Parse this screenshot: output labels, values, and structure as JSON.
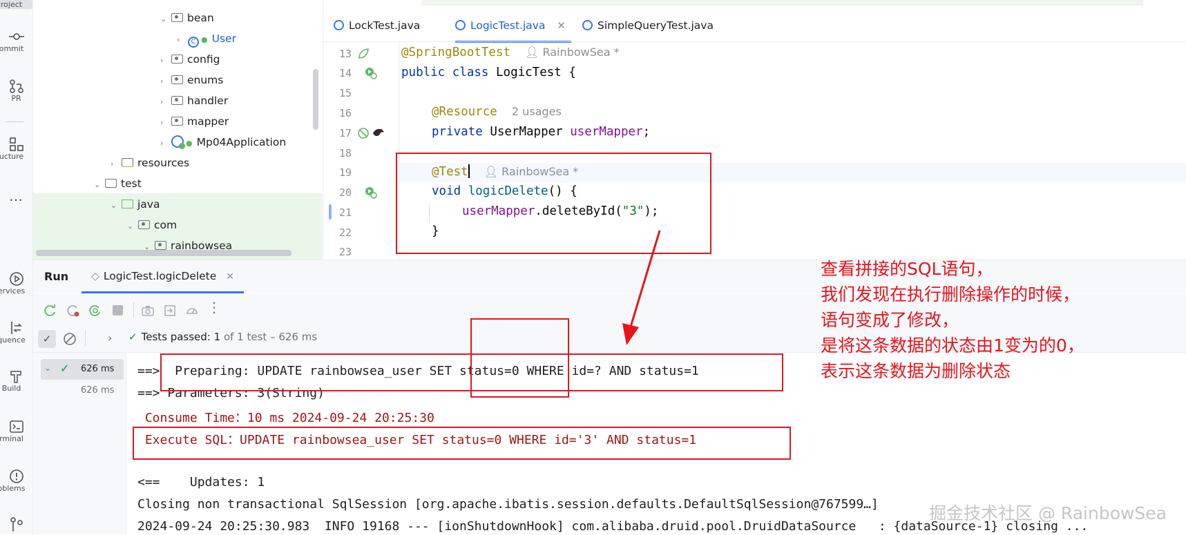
{
  "toolstrip": {
    "items": [
      {
        "label": "Project",
        "icon": "folder-icon"
      },
      {
        "label": "Commit",
        "icon": "commit-icon"
      },
      {
        "label": "PR",
        "icon": "pull-request-icon"
      },
      {
        "label": "Structure",
        "icon": "structure-icon"
      },
      {
        "label": "Services",
        "icon": "services-icon"
      },
      {
        "label": "Sequence",
        "icon": "sequence-icon"
      },
      {
        "label": "Build",
        "icon": "hammer-icon"
      },
      {
        "label": "Terminal",
        "icon": "terminal-icon"
      },
      {
        "label": "Problems",
        "icon": "problems-icon"
      }
    ],
    "labels_visible": [
      "roject",
      "ommit",
      "PR",
      "ucture",
      "ervices",
      "quence",
      "Build",
      "rminal",
      "oblems"
    ]
  },
  "tree": {
    "items": [
      {
        "label": "bean",
        "type": "package"
      },
      {
        "label": "User",
        "type": "class"
      },
      {
        "label": "config",
        "type": "package"
      },
      {
        "label": "enums",
        "type": "package"
      },
      {
        "label": "handler",
        "type": "package"
      },
      {
        "label": "mapper",
        "type": "package"
      },
      {
        "label": "Mp04Application",
        "type": "spring-class"
      },
      {
        "label": "resources",
        "type": "resources-folder"
      },
      {
        "label": "test",
        "type": "folder"
      },
      {
        "label": "java",
        "type": "test-source-folder"
      },
      {
        "label": "com",
        "type": "package"
      },
      {
        "label": "rainbowsea",
        "type": "package"
      }
    ]
  },
  "tabs": [
    {
      "label": "LockTest.java",
      "active": false
    },
    {
      "label": "LogicTest.java",
      "active": true
    },
    {
      "label": "SimpleQueryTest.java",
      "active": false
    }
  ],
  "editor": {
    "line_numbers": [
      "13",
      "14",
      "15",
      "16",
      "17",
      "18",
      "19",
      "20",
      "21",
      "22",
      "23"
    ],
    "l13_annotation": "@SpringBootTest",
    "l13_author": "RainbowSea *",
    "l14_kw1": "public",
    "l14_kw2": "class",
    "l14_name": "LogicTest {",
    "l16_annotation": "@Resource",
    "l16_usages": "2 usages",
    "l17_kw": "private",
    "l17_type": "UserMapper",
    "l17_field": "userMapper",
    "l17_end": ";",
    "l19_annotation": "@Test",
    "l19_author": "RainbowSea *",
    "l20_kw": "void",
    "l20_method": "logicDelete",
    "l20_end": "() {",
    "l21_field": "userMapper",
    "l21_call": ".deleteById(",
    "l21_arg": "\"3\"",
    "l21_end": ");",
    "l22_brace": "}"
  },
  "run": {
    "title": "Run",
    "config_tab": "LogicTest.logicDelete",
    "status_prefix": "Tests passed: ",
    "status_count": "1",
    "status_rest": " of 1 test – 626 ms",
    "tree_time_1": "626 ms",
    "tree_time_2": "626 ms"
  },
  "console": {
    "lines": [
      "==>  Preparing: UPDATE rainbowsea_user SET status=0 WHERE id=? AND status=1",
      "==> Parameters: 3(String)",
      " Consume Time：10 ms 2024-09-24 20:25:30",
      " Execute SQL：UPDATE rainbowsea_user SET status=0 WHERE id='3' AND status=1",
      "<==    Updates: 1",
      "Closing non transactional SqlSession [org.apache.ibatis.session.defaults.DefaultSqlSession@767599…]",
      "2024-09-24 20:25:30.983  INFO 19168 --- [ionShutdownHook] com.alibaba.druid.pool.DruidDataSource   : {dataSource-1} closing ..."
    ]
  },
  "annotation_note": {
    "lines": [
      "查看拼接的SQL语句，",
      "我们发现在执行删除操作的时候，",
      "语句变成了修改，",
      "是将这条数据的状态由1变为的0，",
      "表示这条数据为删除状态"
    ],
    "color": "#e8141c"
  },
  "watermark": "掘金技术社区 @ RainbowSea",
  "colors": {
    "accent": "#3574f0",
    "pass_green": "#208a3c",
    "annotation_red": "#e0161f"
  }
}
